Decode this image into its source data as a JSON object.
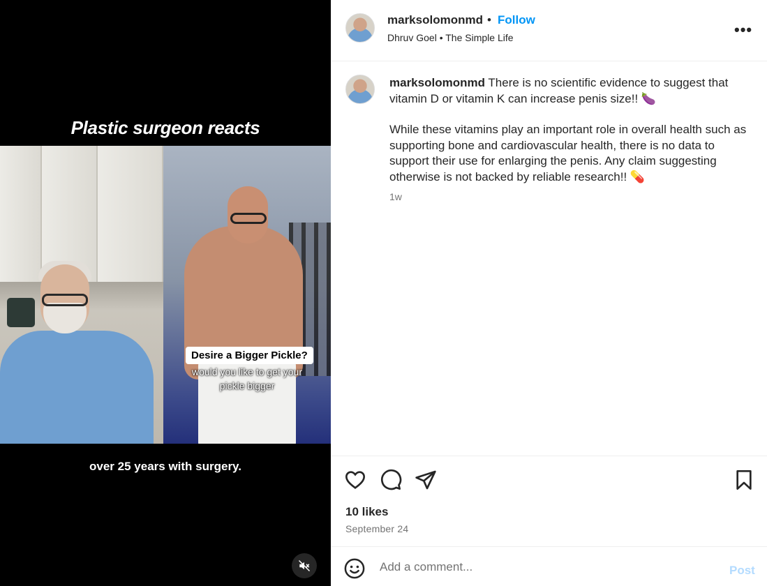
{
  "video": {
    "title": "Plastic surgeon reacts",
    "overlay_box": "Desire a Bigger Pickle?",
    "overlay_sub_1": "would you like to get your",
    "overlay_sub_2": "pickle bigger",
    "bottom_caption": "over 25 years with surgery.",
    "mute_icon": "speaker-muted-icon"
  },
  "header": {
    "username": "marksolomonmd",
    "separator": "•",
    "follow_label": "Follow",
    "audio_artist": "Dhruv Goel",
    "audio_separator": "•",
    "audio_title": "The Simple Life",
    "more_icon": "more-options-icon",
    "more_label": "•••"
  },
  "post": {
    "username": "marksolomonmd",
    "paragraph1": "There is no scientific evidence to suggest that vitamin D or vitamin K can increase penis size!! 🍆",
    "paragraph2": "While these vitamins play an important role in overall health such as supporting bone and cardiovascular health, there is no data to support their use for enlarging the penis. Any claim suggesting otherwise is not backed by reliable research!! 💊",
    "time": "1w"
  },
  "actions": {
    "like_icon": "heart-icon",
    "comment_icon": "comment-bubble-icon",
    "share_icon": "paper-plane-icon",
    "save_icon": "bookmark-icon",
    "likes_text": "10 likes",
    "date": "September 24"
  },
  "comment": {
    "emoji_icon": "smiley-icon",
    "placeholder": "Add a comment...",
    "post_label": "Post"
  },
  "colors": {
    "link_blue": "#0095f6",
    "post_disabled": "#b3dbff",
    "secondary_text": "#737373"
  }
}
